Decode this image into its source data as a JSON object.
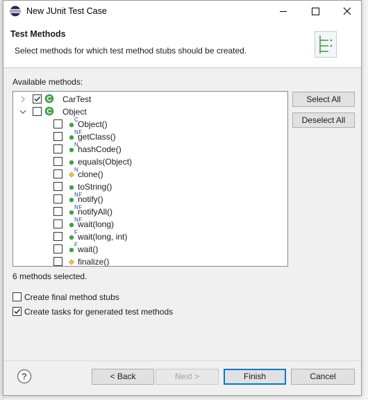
{
  "window": {
    "title": "New JUnit Test Case"
  },
  "header": {
    "title": "Test Methods",
    "description": "Select methods for which test method stubs should be created."
  },
  "available_label": "Available methods:",
  "tree": [
    {
      "label": "CarTest",
      "level": 0,
      "expander": "collapsed",
      "checked": true,
      "icon": "class-icon",
      "modifier": ""
    },
    {
      "label": "Object",
      "level": 0,
      "expander": "expanded",
      "checked": false,
      "icon": "class-icon",
      "modifier": ""
    },
    {
      "label": "Object()",
      "level": 1,
      "checked": false,
      "icon": "public-method-icon",
      "modifier": "C"
    },
    {
      "label": "getClass()",
      "level": 1,
      "checked": false,
      "icon": "public-method-icon",
      "modifier": "NF"
    },
    {
      "label": "hashCode()",
      "level": 1,
      "checked": false,
      "icon": "public-method-icon",
      "modifier": "N"
    },
    {
      "label": "equals(Object)",
      "level": 1,
      "checked": false,
      "icon": "public-method-icon",
      "modifier": ""
    },
    {
      "label": "clone()",
      "level": 1,
      "checked": false,
      "icon": "protected-method-icon",
      "modifier": "N"
    },
    {
      "label": "toString()",
      "level": 1,
      "checked": false,
      "icon": "public-method-icon",
      "modifier": ""
    },
    {
      "label": "notify()",
      "level": 1,
      "checked": false,
      "icon": "public-method-icon",
      "modifier": "NF"
    },
    {
      "label": "notifyAll()",
      "level": 1,
      "checked": false,
      "icon": "public-method-icon",
      "modifier": "NF"
    },
    {
      "label": "wait(long)",
      "level": 1,
      "checked": false,
      "icon": "public-method-icon",
      "modifier": "NF"
    },
    {
      "label": "wait(long, int)",
      "level": 1,
      "checked": false,
      "icon": "public-method-icon",
      "modifier": "F"
    },
    {
      "label": "wait()",
      "level": 1,
      "checked": false,
      "icon": "public-method-icon",
      "modifier": "F"
    },
    {
      "label": "finalize()",
      "level": 1,
      "checked": false,
      "icon": "protected-method-icon",
      "modifier": ""
    }
  ],
  "side_buttons": {
    "select_all": "Select All",
    "deselect_all": "Deselect All"
  },
  "status": "6 methods selected.",
  "options": {
    "final_stubs": {
      "label": "Create final method stubs",
      "checked": false
    },
    "tasks": {
      "label": "Create tasks for generated test methods",
      "checked": true
    }
  },
  "buttons": {
    "back": "< Back",
    "next": "Next >",
    "finish": "Finish",
    "cancel": "Cancel"
  },
  "colors": {
    "class_green": "#3fa147",
    "method_green": "#3fa147",
    "protected_yellow": "#f4c430",
    "default_blue": "#0078d7"
  }
}
